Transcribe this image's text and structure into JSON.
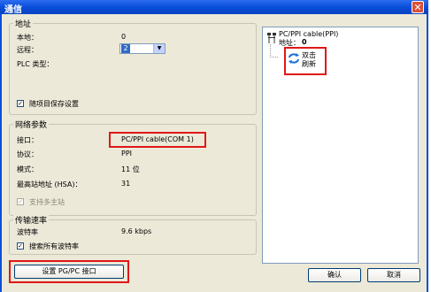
{
  "window": {
    "title": "通信"
  },
  "address_group": {
    "title": "地址",
    "local_label": "本地：",
    "local_value": "0",
    "remote_label": "远程：",
    "remote_value": "2",
    "plc_type_label": "PLC 类型：",
    "save_with_project_label": "随项目保存设置"
  },
  "network_group": {
    "title": "网络参数",
    "interface_label": "接口：",
    "interface_value": "PC/PPI cable(COM 1)",
    "protocol_label": "协议：",
    "protocol_value": "PPI",
    "mode_label": "模式：",
    "mode_value": "11 位",
    "hsa_label": "最高站地址 (HSA)：",
    "hsa_value": "31",
    "multi_master_label": "支持多主站"
  },
  "rate_group": {
    "title": "传输速率",
    "baud_label": "波特率",
    "baud_value": "9.6 kbps",
    "search_all_label": "搜索所有波特率"
  },
  "tree": {
    "cable_name": "PC/PPI cable(PPI)",
    "address_label": "地址：",
    "address_value": "0",
    "refresh_line1": "双击",
    "refresh_line2": "刷新"
  },
  "buttons": {
    "set_pgpc": "设置 PG/PC 接口",
    "ok": "确认",
    "cancel": "取消"
  },
  "colors": {
    "title_bar": "#0a4fd8",
    "highlight": "#e01818",
    "dialog_bg": "#ece9d8"
  }
}
